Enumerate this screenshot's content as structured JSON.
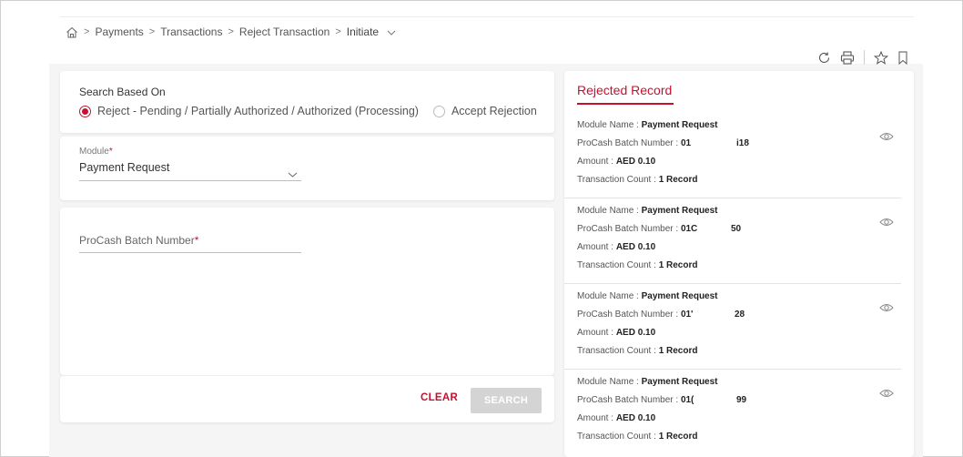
{
  "breadcrumb": {
    "items": [
      "Payments",
      "Transactions",
      "Reject Transaction",
      "Initiate"
    ],
    "separator": ">"
  },
  "toolbar": {
    "icons": [
      "refresh-icon",
      "print-icon",
      "star-icon",
      "bookmark-icon"
    ]
  },
  "search": {
    "title": "Search Based On",
    "options": [
      {
        "label": "Reject - Pending / Partially Authorized / Authorized (Processing)",
        "selected": true
      },
      {
        "label": "Accept Rejection",
        "selected": false
      }
    ]
  },
  "module": {
    "label": "Module",
    "required_mark": "*",
    "value": "Payment Request"
  },
  "batch": {
    "label": "ProCash Batch Number",
    "required_mark": "*"
  },
  "actions": {
    "clear_label": "CLEAR",
    "search_label": "SEARCH"
  },
  "rejected": {
    "title": "Rejected Record",
    "labels": {
      "module": "Module Name : ",
      "batch": "ProCash Batch Number : ",
      "amount": "Amount : ",
      "count": "Transaction Count : "
    },
    "records": [
      {
        "module": "Payment Request",
        "batch_start": "01",
        "batch_end": "i18",
        "amount": "AED 0.10",
        "count": "1 Record"
      },
      {
        "module": "Payment Request",
        "batch_start": "01C",
        "batch_end": "50",
        "amount": "AED 0.10",
        "count": "1 Record"
      },
      {
        "module": "Payment Request",
        "batch_start": "01'",
        "batch_end": "28",
        "amount": "AED 0.10",
        "count": "1 Record"
      },
      {
        "module": "Payment Request",
        "batch_start": "01(",
        "batch_end": "99",
        "amount": "AED 0.10",
        "count": "1 Record"
      }
    ]
  },
  "colors": {
    "accent": "#c8102e",
    "disabled_button": "#d4d4d4"
  }
}
